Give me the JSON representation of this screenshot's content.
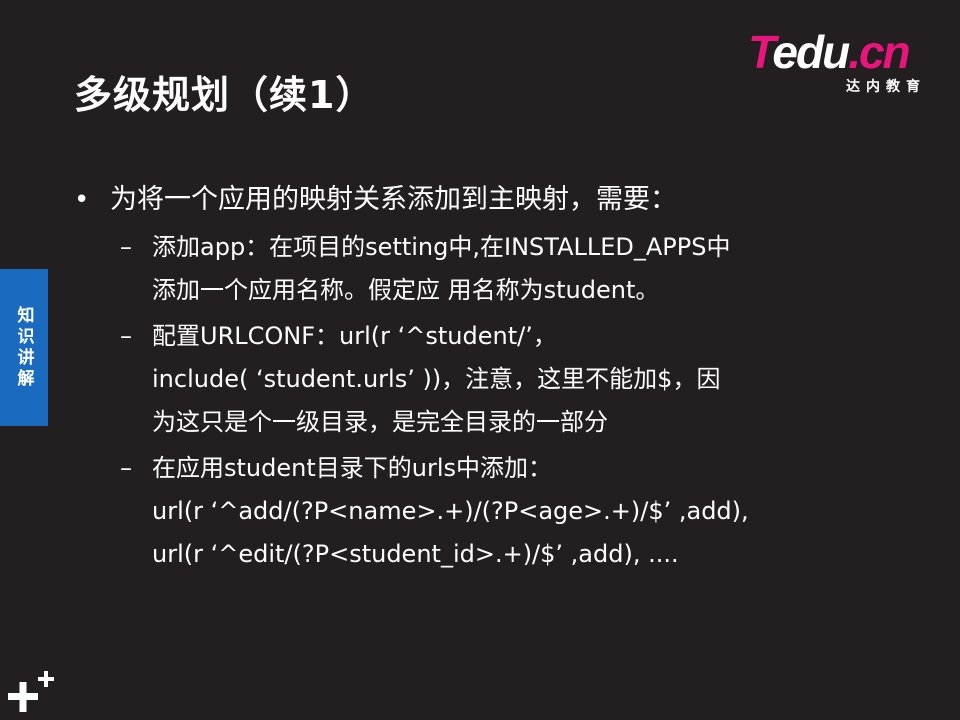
{
  "slide": {
    "title": "多级规划（续1）",
    "logo": {
      "brand_t": "T",
      "brand_edu": "edu",
      "brand_dot_cn": ".cn",
      "subtitle": "达内教育"
    },
    "side_tab": "知识讲解",
    "bullet": {
      "text": "为将一个应用的映射关系添加到主映射，需要：",
      "sub_items": [
        {
          "lines": [
            "添加app：在项目的setting中,在INSTALLED_APPS中",
            "添加一个应用名称。假定应 用名称为student。"
          ]
        },
        {
          "lines": [
            "配置URLCONF：url(r ‘^student/’，",
            "include( ‘student.urls’ ))，注意，这里不能加$，因",
            "为这只是个一级目录，是完全目录的一部分"
          ]
        },
        {
          "lines": [
            "在应用student目录下的urls中添加：",
            "url(r ‘^add/(?P<name>.+)/(?P<age>.+)/$’ ,add),",
            "url(r ‘^edit/(?P<student_id>.+)/$’ ,add), ...."
          ]
        }
      ]
    }
  },
  "colors": {
    "background": "#231f20",
    "text": "#ffffff",
    "accent": "#1a6bbf",
    "brand": "#e8157a"
  },
  "icons": {
    "plus": "plus-logo-icon"
  }
}
